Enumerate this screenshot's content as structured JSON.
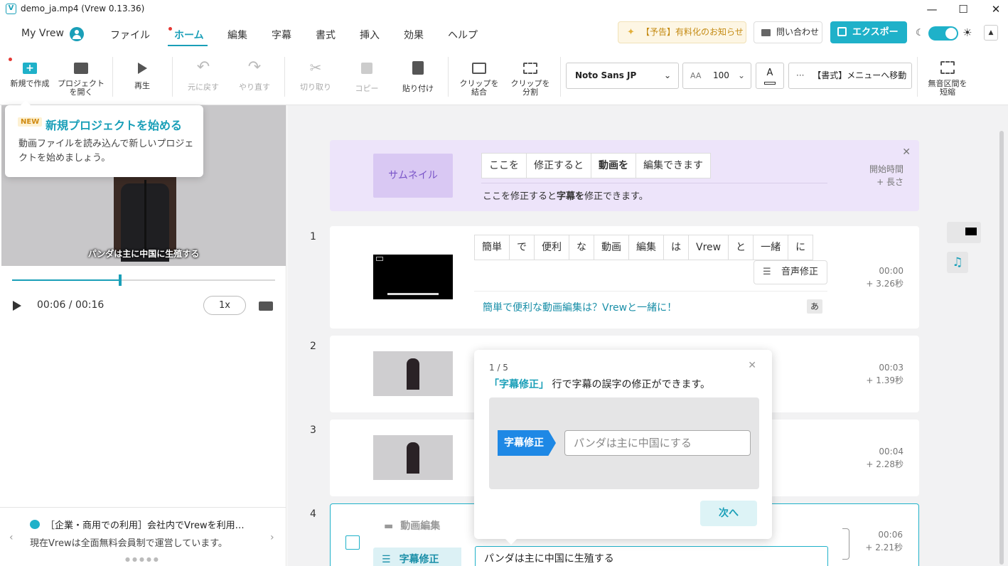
{
  "window": {
    "title": "demo_ja.mp4 (Vrew 0.13.36)",
    "app_icon": "V",
    "minimize": "—",
    "maximize": "☐",
    "close": "✕"
  },
  "menubar": {
    "myvrew": "My Vrew",
    "items": [
      "ファイル",
      "ホーム",
      "編集",
      "字幕",
      "書式",
      "挿入",
      "効果",
      "ヘルプ"
    ],
    "active": "ホーム",
    "notice": "【予告】有料化のお知らせ",
    "contact": "問い合わせ",
    "export": "エクスポート",
    "accent_color": "#1fb1c9"
  },
  "toolbar": {
    "new_project": "新規で作成",
    "open_project_1": "プロジェクト",
    "open_project_2": "を開く",
    "play": "再生",
    "undo": "元に戻す",
    "redo": "やり直す",
    "cut": "切り取り",
    "copy": "コピー",
    "paste": "貼り付け",
    "merge_1": "クリップを",
    "merge_2": "結合",
    "split_1": "クリップを",
    "split_2": "分割",
    "font_name": "Noto Sans JP",
    "font_size": "100",
    "font_color_letter": "A",
    "format_menu": "【書式】メニューへ移動",
    "shorten_1": "無音区間を",
    "shorten_2": "短縮"
  },
  "tooltip_new": {
    "badge": "NEW",
    "title": "新規プロジェクトを始める",
    "desc": "動画ファイルを読み込んで新しいプロジェクトを始めましょう。"
  },
  "player": {
    "subtitle": "パンダは主に中国に生殖する",
    "timecode": "00:06 / 00:16",
    "speed": "1x",
    "progress_fraction": 0.41
  },
  "bottom_info": {
    "title": "［企業・商用での利用］会社内でVrewを利用…",
    "desc": "現在Vrewは全面無料会員制で運営しています。"
  },
  "thumbnail_card": {
    "label": "サムネイル",
    "words": [
      "ここを",
      "修正すると",
      "動画を",
      "編集できます"
    ],
    "caption_pre": "ここを修正すると",
    "caption_bold": "字幕を",
    "caption_post": "修正できます。",
    "time_label": "開始時間",
    "length_label": "+ 長さ"
  },
  "clips": [
    {
      "num": "1",
      "words": [
        "簡単",
        "で",
        "便利",
        "な",
        "動画",
        "編集",
        "は",
        "Vrew",
        "と",
        "一緒",
        "に"
      ],
      "audio_fix": "音声修正",
      "caption": "簡単で便利な動画編集は？Vrewと一緒に！",
      "kana": "あ",
      "start": "00:00",
      "dur": "+ 3.26秒"
    },
    {
      "num": "2",
      "start": "00:03",
      "dur": "+ 1.39秒"
    },
    {
      "num": "3",
      "start": "00:04",
      "dur": "+ 2.28秒"
    },
    {
      "num": "4",
      "video_edit": "動画編集",
      "subtitle_edit": "字幕修正",
      "caption": "パンダは主に中国に生殖する",
      "start": "00:06",
      "dur": "+ 2.21秒"
    }
  ],
  "popup": {
    "counter": "1 / 5",
    "highlight": "「字幕修正」",
    "message": "行で字幕の誤字の修正ができます。",
    "demo_tag": "字幕修正",
    "demo_input": "パンダは主に中国にする",
    "next": "次へ"
  }
}
